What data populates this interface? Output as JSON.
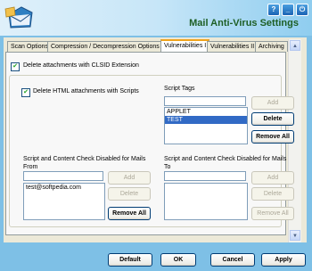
{
  "window": {
    "title": "Mail Anti-Virus Settings",
    "controls": {
      "help": "?",
      "minimize": "_",
      "power": "⏻"
    }
  },
  "tabs": [
    {
      "label": "Scan Options",
      "active": false
    },
    {
      "label": "Compression / Decompression Options",
      "active": false
    },
    {
      "label": "Vulnerabilities I",
      "active": true
    },
    {
      "label": "Vulnerabilities II",
      "active": false
    },
    {
      "label": "Archiving",
      "active": false
    }
  ],
  "options": {
    "delete_clsid": {
      "label": "Delete attachments with CLSID Extension",
      "checked": true
    },
    "delete_html": {
      "label": "Delete HTML attachments with Scripts",
      "checked": true
    }
  },
  "script_tags": {
    "label": "Script Tags",
    "input_value": "",
    "items": [
      "APPLET",
      "TEST"
    ],
    "selected_index": 1,
    "add_label": "Add",
    "delete_label": "Delete",
    "remove_all_label": "Remove All"
  },
  "from_list": {
    "label": "Script and Content Check Disabled for Mails From",
    "input_value": "",
    "items": [
      "test@softpedia.com"
    ],
    "add_label": "Add",
    "delete_label": "Delete",
    "remove_all_label": "Remove All"
  },
  "to_list": {
    "label": "Script and Content Check Disabled for Mails To",
    "input_value": "",
    "items": [],
    "add_label": "Add",
    "delete_label": "Delete",
    "remove_all_label": "Remove All"
  },
  "footer": {
    "default_label": "Default",
    "ok_label": "OK",
    "cancel_label": "Cancel",
    "apply_label": "Apply"
  },
  "colors": {
    "title_text": "#1d5e24",
    "active_tab_accent": "#f0a31c",
    "selection": "#316ac5",
    "background": "#7ec0e6"
  }
}
